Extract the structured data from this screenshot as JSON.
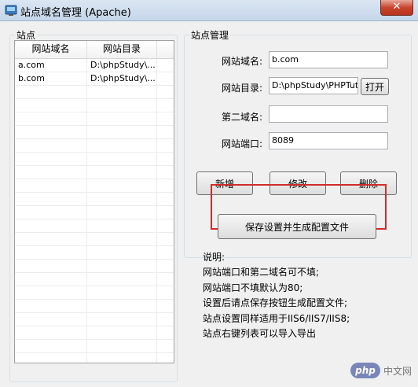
{
  "window": {
    "title": "站点域名管理 (Apache)",
    "close_glyph": "✕"
  },
  "sites_panel": {
    "title": "站点",
    "columns": [
      "网站域名",
      "网站目录"
    ],
    "rows": [
      {
        "domain": "a.com",
        "dir": "D:\\phpStudy\\..."
      },
      {
        "domain": "b.com",
        "dir": "D:\\phpStudy\\..."
      }
    ]
  },
  "manage_panel": {
    "title": "站点管理",
    "domain_label": "网站域名:",
    "domain_value": "b.com",
    "dir_label": "网站目录:",
    "dir_value": "D:\\phpStudy\\PHPTuto",
    "open_button": "打开",
    "second_domain_label": "第二域名:",
    "second_domain_value": "",
    "port_label": "网站端口:",
    "port_value": "8089",
    "add_button": "新增",
    "modify_button": "修改",
    "delete_button": "删除",
    "save_button": "保存设置并生成配置文件"
  },
  "notes": {
    "heading": "说明:",
    "lines": [
      "网站端口和第二域名可不填;",
      "网站端口不填默认为80;",
      "设置后请点保存按钮生成配置文件;",
      "站点设置同样适用于IIS6/IIS7/IIS8;",
      "站点右键列表可以导入导出"
    ]
  },
  "watermark": {
    "logo_text": "php",
    "site_text": "中文网"
  },
  "colors": {
    "highlight": "#d22b2b"
  }
}
